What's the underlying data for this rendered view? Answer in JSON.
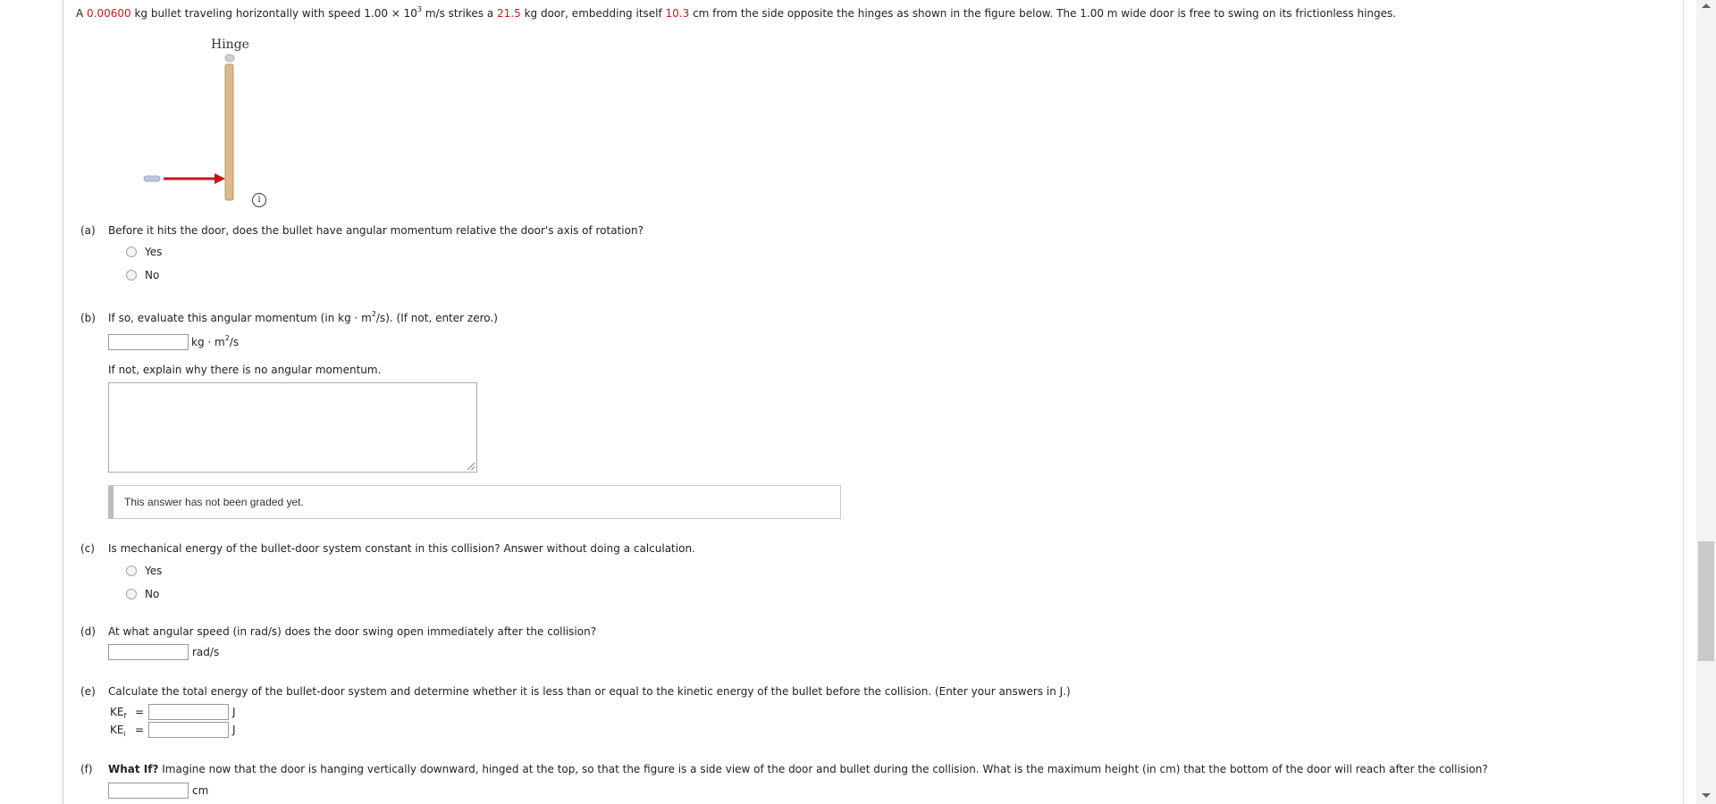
{
  "problem": {
    "t1": "A ",
    "bullet_mass": "0.00600",
    "t2": " kg bullet traveling horizontally with speed 1.00 × 10",
    "exp": "3",
    "t3": " m/s strikes a ",
    "door_mass": "21.5",
    "t4": " kg door, embedding itself ",
    "embed_dist": "10.3",
    "t5": " cm from the side opposite the hinges as shown in the figure below. The 1.00 m wide door is free to swing on its frictionless hinges."
  },
  "figure": {
    "hinge_label": "Hinge",
    "info_icon": "i"
  },
  "colors": {
    "given_value": "#c51e1e",
    "arrow": "#c8161d",
    "door": "#ddb98c",
    "bullet": "#b8c9dd"
  },
  "qa": {
    "label": "(a)",
    "text": "Before it hits the door, does the bullet have angular momentum relative the door's axis of rotation?",
    "options": [
      "Yes",
      "No"
    ]
  },
  "qb": {
    "label": "(b)",
    "text1": "If so, evaluate this angular momentum (in kg · m",
    "sup": "2",
    "text2": "/s). (If not, enter zero.)",
    "unit1": "kg · m",
    "unit_sup": "2",
    "unit2": "/s",
    "explain_prompt": "If not, explain why there is no angular momentum.",
    "graded_text": "This answer has not been graded yet."
  },
  "qc": {
    "label": "(c)",
    "text": "Is mechanical energy of the bullet-door system constant in this collision? Answer without doing a calculation.",
    "options": [
      "Yes",
      "No"
    ]
  },
  "qd": {
    "label": "(d)",
    "text": "At what angular speed (in rad/s) does the door swing open immediately after the collision?",
    "unit": "rad/s"
  },
  "qe": {
    "label": "(e)",
    "text": "Calculate the total energy of the bullet-door system and determine whether it is less than or equal to the kinetic energy of the bullet before the collision. (Enter your answers in J.)",
    "kef": "KE",
    "kef_sub": "f",
    "kei": "KE",
    "kei_sub": "i",
    "eq": "=",
    "unit": "J"
  },
  "qf": {
    "label": "(f)",
    "bold": "What If?",
    "text": " Imagine now that the door is hanging vertically downward, hinged at the top, so that the figure is a side view of the door and bullet during the collision. What is the maximum height (in cm) that the bottom of the door will reach after the collision?",
    "unit": "cm"
  }
}
